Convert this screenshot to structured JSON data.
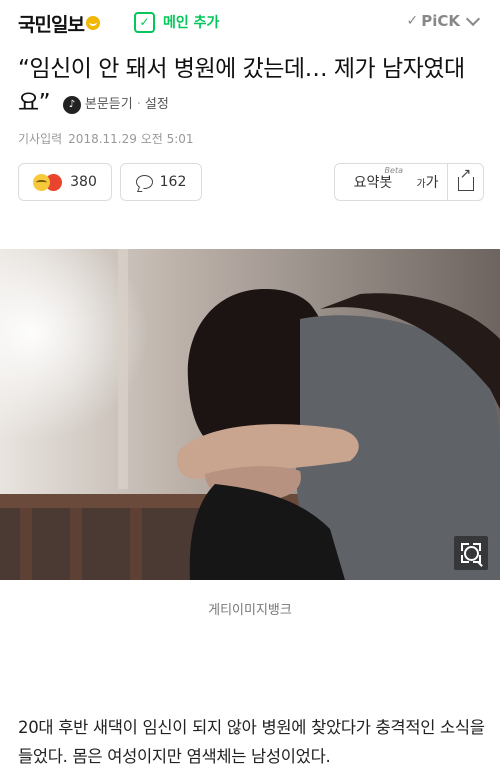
{
  "header": {
    "logo_text": "국민일보",
    "main_add_label": "메인 추가",
    "pick_label": "PiCK"
  },
  "article": {
    "title": "“임신이 안 돼서 병원에 갔는데… 제가 남자였대요”",
    "audio_label": "본문듣기",
    "settings_label": "설정",
    "date_prefix": "기사입력",
    "date": "2018.11.29 오전 5:01",
    "reactions_count": "380",
    "comments_count": "162",
    "summary_label": "요약봇",
    "summary_badge": "Beta",
    "font_label_small": "가",
    "font_label_large": "가",
    "photo_caption": "게티이미지뱅크",
    "body": "20대 후반 새댁이 임신이 되지 않아 병원에 찾았다가 충격적인 소식을 들었다. 몸은 여성이지만 염색체는 남성이었다."
  },
  "colors": {
    "brand_green": "#03c75a",
    "reaction_sad": "#f6c93b",
    "reaction_angry": "#e8442e"
  }
}
